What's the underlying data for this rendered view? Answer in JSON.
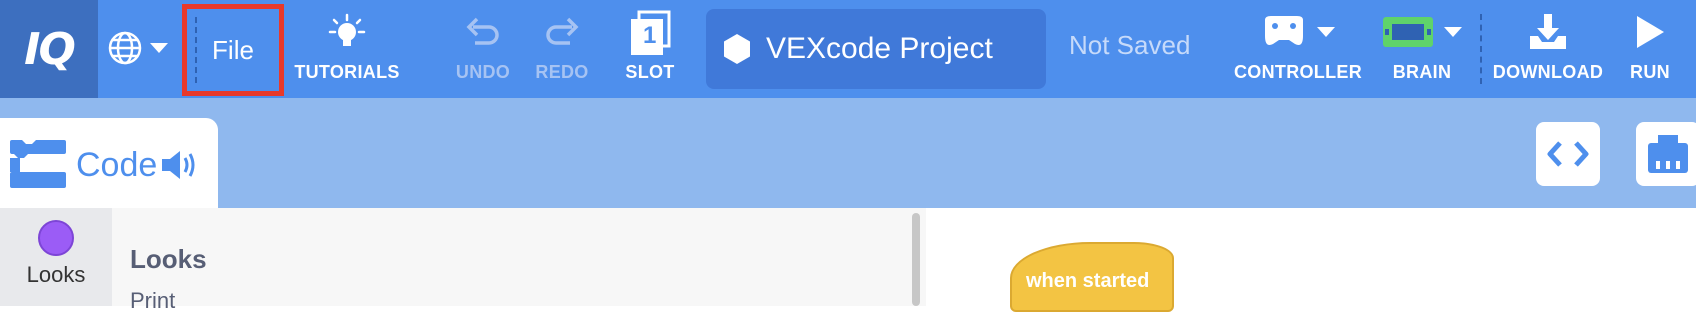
{
  "header": {
    "logo": "IQ",
    "file_label": "File",
    "tutorials_label": "TUTORIALS",
    "undo_label": "UNDO",
    "redo_label": "REDO",
    "slot_label": "SLOT",
    "slot_number": "1",
    "project_name": "VEXcode Project",
    "save_status": "Not Saved",
    "controller_label": "CONTROLLER",
    "brain_label": "BRAIN",
    "download_label": "DOWNLOAD",
    "run_label": "RUN"
  },
  "toolbar": {
    "code_tab_label": "Code"
  },
  "categories": [
    {
      "label": "Looks",
      "color": "#9b5cf6"
    }
  ],
  "palette": {
    "title": "Looks",
    "items": [
      "Print"
    ]
  },
  "workspace": {
    "hat_block_text": "when started"
  },
  "colors": {
    "topbar": "#4e8fed",
    "logo_bg": "#3d6fbf",
    "highlight_border": "#e8392b",
    "toolbar_row": "#8fb8ee",
    "brain_green": "#5fd36b",
    "event_block": "#f3c443"
  },
  "icons": [
    "globe-icon",
    "lightbulb-icon",
    "undo-icon",
    "redo-icon",
    "slot-icon",
    "hexagon-icon",
    "controller-icon",
    "brain-icon",
    "download-icon",
    "run-icon",
    "code-blocks-icon",
    "speaker-icon",
    "code-brackets-icon",
    "device-icon"
  ]
}
